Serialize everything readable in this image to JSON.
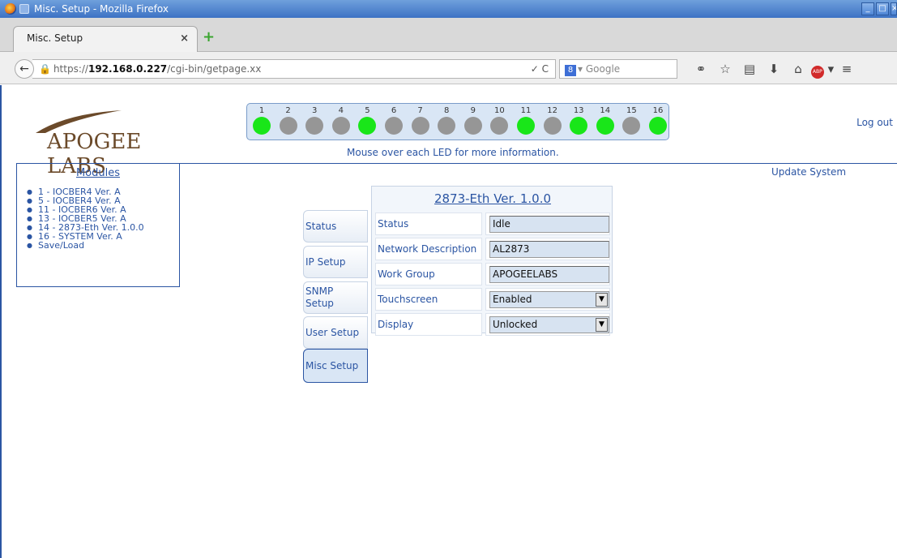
{
  "window": {
    "title": "Misc. Setup - Mozilla Firefox"
  },
  "tab": {
    "label": "Misc. Setup",
    "close": "×",
    "new_tab": "+"
  },
  "nav": {
    "back": "←",
    "url_prefix": "https://",
    "url_host": "192.168.0.227",
    "url_path": "/cgi-bin/getpage.xx",
    "url_tail": "✓ C",
    "search_engine": "8",
    "search_placeholder": "Google",
    "icons": [
      "binoculars-icon",
      "bookmark-star-icon",
      "reading-list-icon",
      "download-icon",
      "home-icon",
      "adblock-icon",
      "menu-icon"
    ]
  },
  "header": {
    "brand": "APOGEE LABS",
    "logout": "Log out",
    "led_hint": "Mouse over each LED for more information.",
    "update_system": "Update System",
    "colors": {
      "led_on": "#19e619",
      "led_off": "#969696",
      "link": "#2b55a3"
    }
  },
  "leds": [
    {
      "num": "1",
      "on": true
    },
    {
      "num": "2",
      "on": false
    },
    {
      "num": "3",
      "on": false
    },
    {
      "num": "4",
      "on": false
    },
    {
      "num": "5",
      "on": true
    },
    {
      "num": "6",
      "on": false
    },
    {
      "num": "7",
      "on": false
    },
    {
      "num": "8",
      "on": false
    },
    {
      "num": "9",
      "on": false
    },
    {
      "num": "10",
      "on": false
    },
    {
      "num": "11",
      "on": true
    },
    {
      "num": "12",
      "on": false
    },
    {
      "num": "13",
      "on": true
    },
    {
      "num": "14",
      "on": true
    },
    {
      "num": "15",
      "on": false
    },
    {
      "num": "16",
      "on": true
    }
  ],
  "modules": {
    "heading": "Modules",
    "items": [
      "1 - IOCBER4 Ver. A",
      "5 - IOCBER4 Ver. A",
      "11 - IOCBER6 Ver. A",
      "13 - IOCBER5 Ver. A",
      "14 - 2873-Eth Ver. 1.0.0",
      "16 - SYSTEM Ver. A",
      "Save/Load"
    ]
  },
  "side_tabs": [
    "Status",
    "IP Setup",
    "SNMP Setup",
    "User Setup",
    "Misc Setup"
  ],
  "panel": {
    "title": "2873-Eth Ver. 1.0.0",
    "rows": [
      {
        "label": "Status",
        "value": "Idle"
      },
      {
        "label": "Network Description",
        "value": "AL2873"
      },
      {
        "label": "Work Group",
        "value": "APOGEELABS"
      },
      {
        "label": "Touchscreen",
        "value": "Enabled"
      },
      {
        "label": "Display",
        "value": "Unlocked"
      }
    ]
  }
}
